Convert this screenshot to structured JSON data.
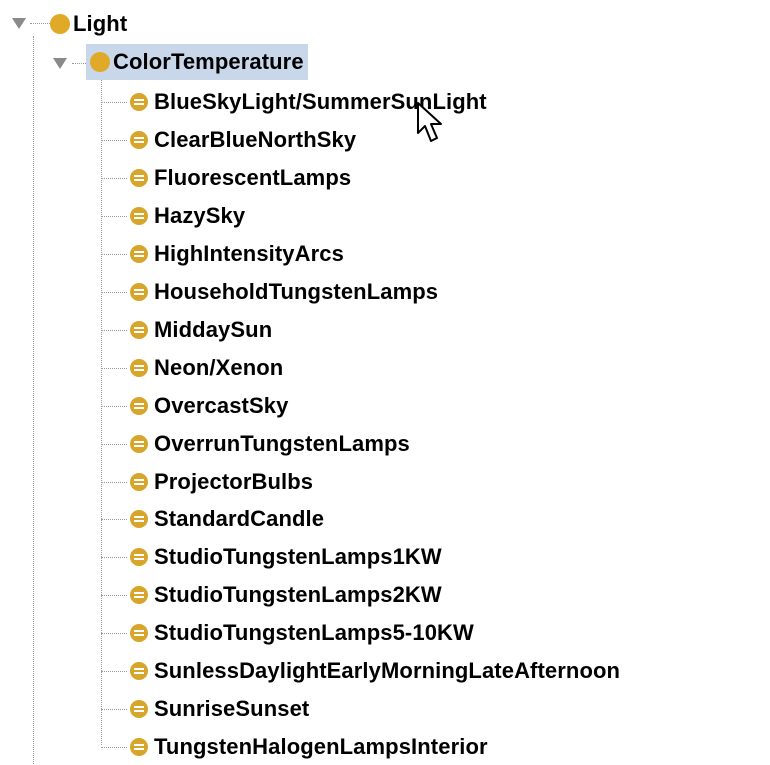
{
  "tree": {
    "root": {
      "label": "Light",
      "expanded": true
    },
    "child": {
      "label": "ColorTemperature",
      "expanded": true,
      "selected": true
    },
    "individuals": [
      "BlueSkyLight/SummerSunLight",
      "ClearBlueNorthSky",
      "FluorescentLamps",
      "HazySky",
      "HighIntensityArcs",
      "HouseholdTungstenLamps",
      "MiddaySun",
      "Neon/Xenon",
      "OvercastSky",
      "OverrunTungstenLamps",
      "ProjectorBulbs",
      "StandardCandle",
      "StudioTungstenLamps1KW",
      "StudioTungstenLamps2KW",
      "StudioTungstenLamps5-10KW",
      "SunlessDaylightEarlyMorningLateAfternoon",
      "SunriseSunset",
      "TungstenHalogenLampsInterior"
    ]
  },
  "colors": {
    "class_icon": "#e0a928",
    "individual_icon": "#d7a52a",
    "selection": "#c8d7ea",
    "guide_lines": "#9a9a9a"
  },
  "icons": {
    "expand_toggle": "triangle-down-icon",
    "class": "class-circle-icon",
    "individual": "individual-icon",
    "pointer": "mouse-pointer-icon"
  }
}
